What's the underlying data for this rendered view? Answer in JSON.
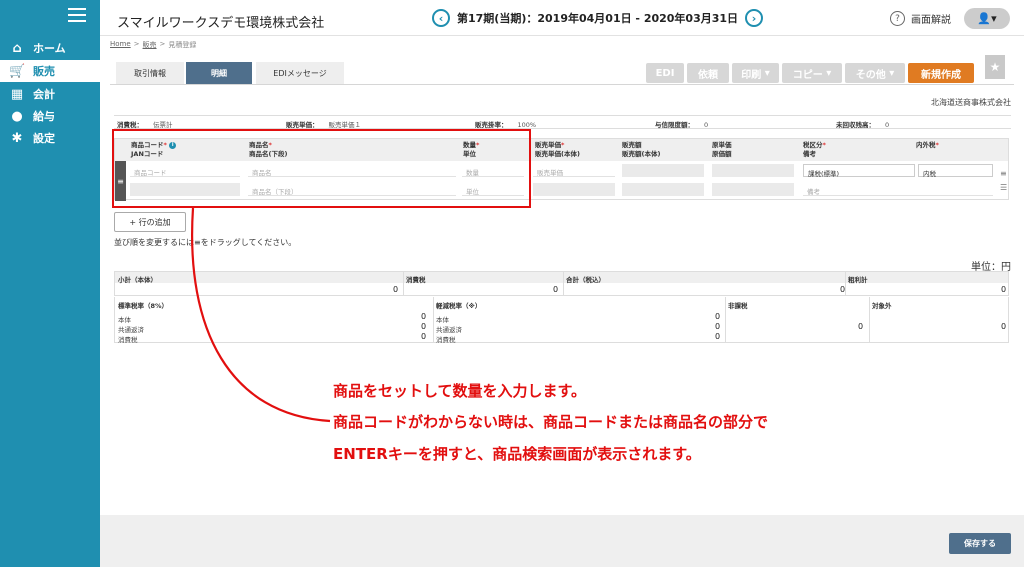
{
  "sidebar": {
    "items": [
      {
        "label": "ホーム",
        "icon": "home-icon"
      },
      {
        "label": "販売",
        "icon": "cart-icon"
      },
      {
        "label": "会計",
        "icon": "calculator-icon"
      },
      {
        "label": "給与",
        "icon": "money-bag-icon"
      },
      {
        "label": "設定",
        "icon": "gear-icon"
      }
    ]
  },
  "header": {
    "company": "スマイルワークスデモ環境株式会社",
    "period": "第17期(当期)：2019年04月01日 - 2020年03月31日",
    "help": "画面解説"
  },
  "breadcrumb": {
    "home": "Home",
    "sep1": ">",
    "sales": "販売",
    "sep2": ">",
    "current": "見積登録"
  },
  "tabs": {
    "trade_info": "取引情報",
    "details": "明細",
    "edi_message": "EDIメッセージ"
  },
  "toolbar": {
    "edi": "EDI",
    "request": "依頼",
    "print": "印刷",
    "copy": "コピー",
    "other": "その他",
    "new": "新規作成"
  },
  "customer_name": "北海道送商事株式会社",
  "info_bar": {
    "tax_label": "消費税：",
    "tax_value": "伝票計",
    "price_label": "販売単価：",
    "price_value": "販売単価１",
    "rate_label": "販売掛率：",
    "rate_value": "100%",
    "credit_label": "与信限度額：",
    "credit_value": "0",
    "unpaid_label": "未回収残高：",
    "unpaid_value": "0"
  },
  "grid": {
    "h_code": "商品コード",
    "h_jan": "JANコード",
    "h_name": "商品名",
    "h_name2": "商品名(下段)",
    "h_qty": "数量",
    "h_unit": "単位",
    "h_price": "販売単価",
    "h_price_net": "販売単価(本体)",
    "h_amount": "販売額",
    "h_amount_net": "販売額(本体)",
    "h_cost": "原単価",
    "h_cost_amount": "原価額",
    "h_taxcat": "税区分",
    "h_memo": "備考",
    "h_taxinc": "内外税",
    "req": "*",
    "ph_code": "商品コード",
    "ph_name": "商品名",
    "ph_name2": "商品名（下段）",
    "ph_qty": "数量",
    "ph_unit": "単位",
    "ph_price": "販売単価",
    "ph_memo": "備考",
    "taxcat_value": "課税(標準)",
    "taxinc_value": "内税"
  },
  "add_row": "+ 行の追加",
  "drag_hint": "並び順を変更するには≡をドラッグしてください。",
  "unit_label": "単位：円",
  "totals": {
    "subtotal": "小計（本体）",
    "subtotal_v": "0",
    "tax": "消費税",
    "tax_v": "0",
    "total": "合計（税込）",
    "total_v": "0",
    "gross": "粗利計",
    "gross_v": "0"
  },
  "breakdown": {
    "std": "標準税率（8%）",
    "reduced": "軽減税率（※）",
    "nontax": "非課税",
    "exempt": "対象外",
    "body": "本体",
    "common": "共通返済",
    "ctax": "消費税",
    "zero": "0"
  },
  "annotation": {
    "line1": "商品をセットして数量を入力します。",
    "line2": "商品コードがわからない時は、商品コードまたは商品名の部分で",
    "line3": "ENTERキーを押すと、商品検索画面が表示されます。"
  },
  "save": "保存する"
}
